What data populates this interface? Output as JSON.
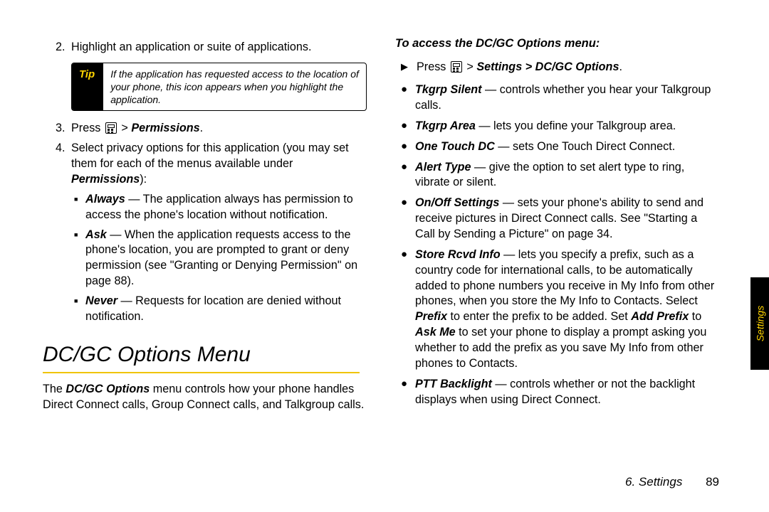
{
  "left": {
    "step2_num": "2.",
    "step2": "Highlight an application or suite of applications.",
    "tip_label": "Tip",
    "tip_text_a": "If the application has requested access to the location of your phone, this icon ",
    "tip_text_b": " appears when you highlight the application.",
    "step3_num": "3.",
    "step3_a": "Press ",
    "step3_b": " > ",
    "step3_perm": "Permissions",
    "step3_c": ".",
    "step4_num": "4.",
    "step4_a": "Select privacy options for this application (you may set them for each of the menus available under ",
    "step4_perm": "Permissions",
    "step4_b": "):",
    "always_t": "Always",
    "always_b": " — The application always has permission to access the phone's location without notification.",
    "ask_t": "Ask",
    "ask_b": " — When the application requests access to the phone's location, you are prompted to grant or deny permission (see \"Granting or Denying Permission\" on page 88).",
    "never_t": "Never",
    "never_b": " — Requests for location are denied without notification.",
    "heading": "DC/GC Options Menu",
    "intro_a": "The ",
    "intro_b": "DC/GC Options",
    "intro_c": " menu controls how your phone handles Direct Connect calls, Group Connect calls, and Talkgroup calls."
  },
  "right": {
    "subhead": "To access the DC/GC Options menu:",
    "press_a": "Press ",
    "press_b": " > ",
    "press_path": "Settings > DC/GC Options",
    "press_c": ".",
    "items": {
      "tkgrp_silent_t": "Tkgrp Silent",
      "tkgrp_silent_b": " — controls whether you hear your Talkgroup calls.",
      "tkgrp_area_t": "Tkgrp Area",
      "tkgrp_area_b": " — lets you define your Talkgroup area.",
      "one_touch_t": "One Touch DC",
      "one_touch_b": " — sets One Touch Direct Connect.",
      "alert_t": "Alert Type",
      "alert_b": " — give the option to set alert type to ring, vibrate or silent.",
      "onoff_t": "On/Off Settings",
      "onoff_b": " — sets your phone's ability to send and receive pictures in Direct Connect calls. See \"Starting a Call by Sending a Picture\" on page 34.",
      "store_t": "Store Rcvd Info",
      "store_b_a": " — lets you specify a prefix, such as a country code for international calls, to be automatically added to phone numbers you receive in My Info from other phones, when you store the My Info to Contacts. Select ",
      "store_prefix": "Prefix",
      "store_b_b": " to enter the prefix to be added. Set ",
      "store_add": "Add Prefix",
      "store_b_c": " to ",
      "store_ask": "Ask Me",
      "store_b_d": " to set your phone to display a prompt asking you whether to add the prefix as you save My Info from other phones to Contacts.",
      "ptt_t": "PTT Backlight",
      "ptt_b": " — controls whether or not the backlight displays when using Direct Connect."
    }
  },
  "side_tab": "Settings",
  "footer_chapter": "6. Settings",
  "footer_page": "89"
}
